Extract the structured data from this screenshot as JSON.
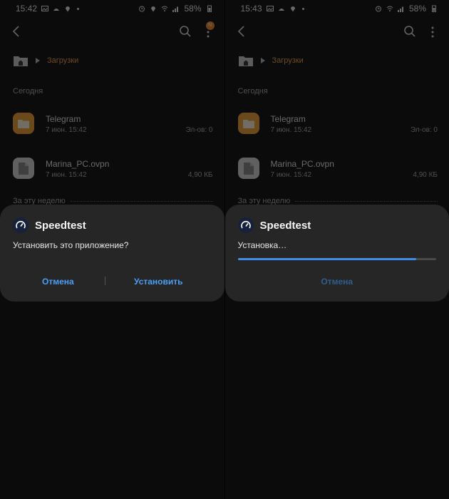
{
  "left": {
    "status": {
      "time": "15:42",
      "battery": "58%"
    },
    "breadcrumb": {
      "folder": "Загрузки"
    },
    "sections": {
      "today": "Сегодня",
      "week": "За эту неделю"
    },
    "files": [
      {
        "name": "Telegram",
        "date": "7 июн. 15:42",
        "meta": "Эл-ов: 0",
        "kind": "folder"
      },
      {
        "name": "Marina_PC.ovpn",
        "date": "7 июн. 15:42",
        "meta": "4,90 КБ",
        "kind": "doc"
      }
    ],
    "dialog": {
      "app_name": "Speedtest",
      "message": "Установить это приложение?",
      "cancel_label": "Отмена",
      "install_label": "Установить"
    }
  },
  "right": {
    "status": {
      "time": "15:43",
      "battery": "58%"
    },
    "breadcrumb": {
      "folder": "Загрузки"
    },
    "sections": {
      "today": "Сегодня",
      "week": "За эту неделю"
    },
    "files": [
      {
        "name": "Telegram",
        "date": "7 июн. 15:42",
        "meta": "Эл-ов: 0",
        "kind": "folder"
      },
      {
        "name": "Marina_PC.ovpn",
        "date": "7 июн. 15:42",
        "meta": "4,90 КБ",
        "kind": "doc"
      }
    ],
    "dialog": {
      "app_name": "Speedtest",
      "message": "Установка…",
      "progress": 0.9,
      "cancel_label": "Отмена"
    }
  },
  "badge_text": "N",
  "colors": {
    "accent": "#4b9ff5",
    "folder": "#f0a030",
    "breadcrumb": "#f0a040",
    "dialog_bg": "#262626",
    "progress": "#3d8fe6"
  }
}
